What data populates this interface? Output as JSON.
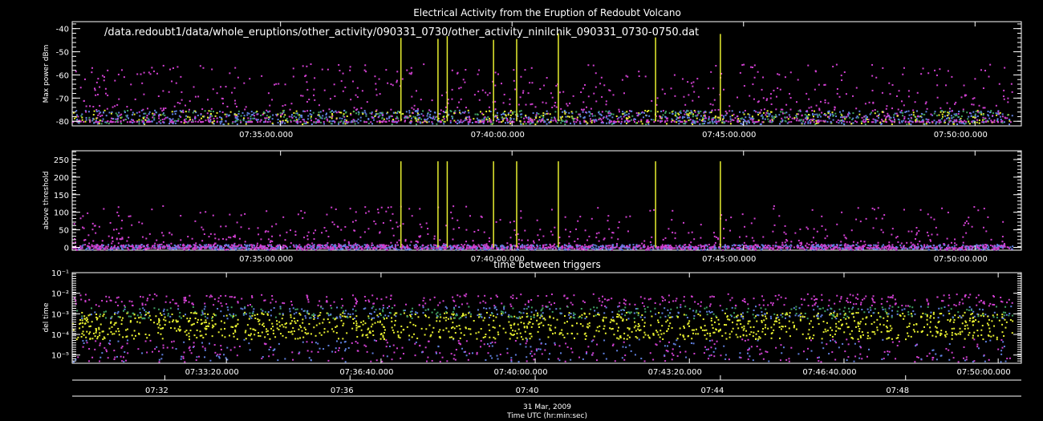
{
  "title": "Electrical Activity from the Eruption of Redoubt Volcano",
  "file_path": "/data.redoubt1/data/whole_eruptions/other_activity/090331_0730/other_activity_ninilchik_090331_0730-0750.dat",
  "colors": {
    "background": "#000000",
    "axes": "#ffffff",
    "magenta": "#d040d0",
    "blue": "#6080e0",
    "green": "#40a060",
    "yellow": "#e8f030",
    "red": "#ff4040"
  },
  "chart_data": [
    {
      "type": "scatter",
      "name": "max-power",
      "ylabel": "Max power dBm",
      "ylim": [
        -82,
        -37
      ],
      "yticks": [
        -80,
        -70,
        -60,
        -50,
        -40
      ],
      "ytick_labels": [
        "-80",
        "-70",
        "-60",
        "-50",
        "-40"
      ],
      "xlim_minutes": [
        0,
        20.5
      ],
      "xticks": [
        4.5,
        9.5,
        14.5,
        19.5
      ],
      "xtick_labels": [
        "07:35:00.000",
        "07:40:00.000",
        "07:45:00.000",
        "07:50:00.000"
      ],
      "baseline_range": [
        -81,
        -75
      ],
      "spike_times_minutes": [
        7.1,
        7.9,
        8.1,
        9.1,
        9.6,
        10.5,
        12.6,
        14.0
      ]
    },
    {
      "type": "scatter",
      "name": "above-threshold",
      "ylabel": "above threshold",
      "ylim": [
        -8,
        275
      ],
      "yticks": [
        0,
        50,
        100,
        150,
        200,
        250
      ],
      "ytick_labels": [
        "0",
        "50",
        "100",
        "150",
        "200",
        "250"
      ],
      "xlim_minutes": [
        0,
        20.5
      ],
      "xticks": [
        4.5,
        9.5,
        14.5,
        19.5
      ],
      "xtick_labels": [
        "07:35:00.000",
        "07:40:00.000",
        "07:45:00.000",
        "07:50:00.000"
      ],
      "spike_times_minutes": [
        7.1,
        7.9,
        8.1,
        9.1,
        9.6,
        10.5,
        12.6,
        14.0
      ]
    },
    {
      "type": "scatter",
      "name": "time-between-triggers",
      "title": "time between triggers",
      "ylabel": "del time",
      "yscale": "log",
      "ylim_exp": [
        -5.4,
        -1
      ],
      "yticks_exp": [
        -5,
        -4,
        -3,
        -2,
        -1
      ],
      "ytick_labels": [
        "10⁻⁵",
        "10⁻⁴",
        "10⁻³",
        "10⁻²",
        "10⁻¹"
      ],
      "xlim_minutes": [
        0,
        20.5
      ],
      "xticks": [
        3.33,
        6.67,
        10.0,
        13.33,
        16.67,
        20.0
      ],
      "xtick_labels": [
        "07:33:20.000",
        "07:36:40.000",
        "07:40:00.000",
        "07:43:20.000",
        "07:46:40.000",
        "07:50:00.000"
      ]
    }
  ],
  "bottom_axis": {
    "ticks": [
      2.0,
      6.0,
      10.0,
      14.0,
      18.0
    ],
    "tick_labels": [
      "07:32",
      "07:36",
      "07:40",
      "07:44",
      "07:48"
    ],
    "date_label": "31 Mar, 2009",
    "xlabel": "Time UTC (hr:min:sec)"
  }
}
